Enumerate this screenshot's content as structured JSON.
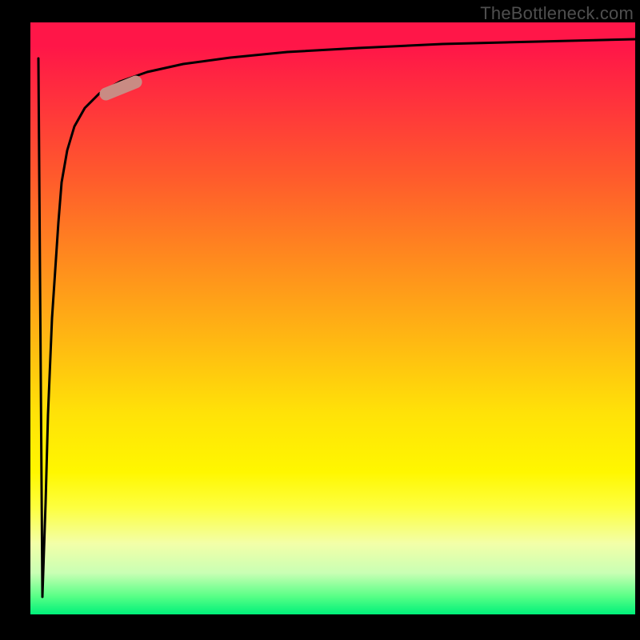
{
  "attribution": "TheBottleneck.com",
  "colors": {
    "frame_background": "#000000",
    "gradient_top": "#ff1648",
    "gradient_mid": "#ffe208",
    "gradient_bottom": "#00f07a",
    "curve_stroke": "#000000",
    "marker_fill": "#c98b83"
  },
  "chart_data": {
    "type": "line",
    "title": "",
    "xlabel": "",
    "ylabel": "",
    "xlim": [
      0,
      100
    ],
    "ylim": [
      0,
      100
    ],
    "grid": false,
    "legend": false,
    "note": "Axes are un-ticked; values below are estimated from pixel positions (origin bottom-left).",
    "series": [
      {
        "name": "curve",
        "x": [
          2.0,
          2.6,
          3.0,
          3.6,
          4.0,
          4.5,
          5.2,
          6.1,
          7.3,
          9.0,
          11.4,
          14.8,
          19.3,
          25.3,
          33.0,
          42.5,
          54.3,
          68.1,
          83.8,
          100.0
        ],
        "y": [
          3.0,
          19.0,
          34.0,
          50.0,
          58.0,
          66.0,
          73.0,
          78.5,
          82.5,
          85.5,
          88.0,
          90.0,
          91.5,
          93.0,
          94.0,
          95.0,
          95.7,
          96.3,
          96.8,
          97.2
        ]
      }
    ],
    "marker": {
      "x": 14.0,
      "y": 89.5,
      "length_pct": 7.0,
      "orientation_deg": 22
    }
  }
}
